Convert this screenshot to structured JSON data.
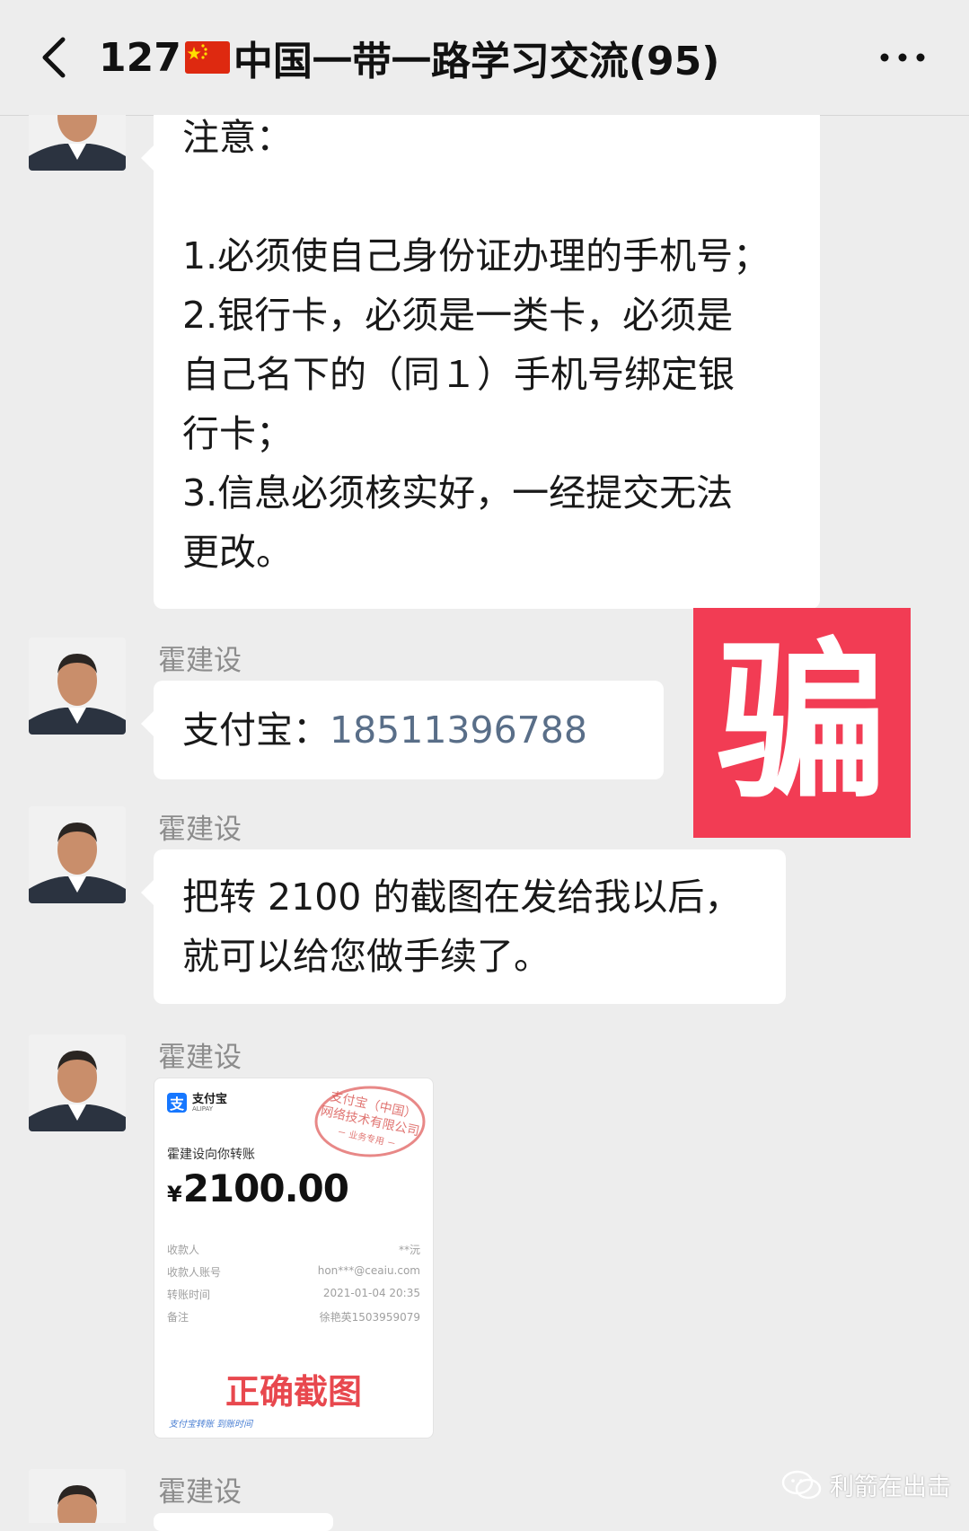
{
  "header": {
    "title_prefix": "127",
    "title_main": "中国一带一路学习交流(95)"
  },
  "messages": [
    {
      "lines": [
        "注意：",
        "",
        "1.必须使自己身份证办理的手机号；",
        "2.银行卡，必须是一类卡，必须是",
        "自己名下的（同１）手机号绑定银",
        "行卡；",
        "3.信息必须核实好，一经提交无法",
        "更改。"
      ]
    },
    {
      "sender": "霍建设",
      "label": "支付宝：",
      "phone": "18511396788"
    },
    {
      "sender": "霍建设",
      "lines": [
        "把转 2100 的截图在发给我以后，",
        "就可以给您做手续了。"
      ]
    },
    {
      "sender": "霍建设",
      "receipt": {
        "logo_text": "支付宝",
        "logo_sub": "ALIPAY",
        "seal_lines": [
          "支付宝（中国）",
          "网络技术有限公司",
          "－ 业务专用 －"
        ],
        "description": "霍建设向你转账",
        "currency": "¥",
        "amount": "2100.00",
        "rows": [
          {
            "label": "收款人",
            "value": "**沅"
          },
          {
            "label": "收款人账号",
            "value": "hon***@ceaiu.com"
          },
          {
            "label": "转账时间",
            "value": "2021-01-04 20:35"
          },
          {
            "label": "备注",
            "value": "徐艳英1503959079"
          }
        ],
        "correct_label": "正确截图",
        "footer": "支付宝转账 到账时间"
      }
    },
    {
      "sender": "霍建设"
    }
  ],
  "stamp": {
    "text": "骗",
    "color": "#f23c54"
  },
  "watermark": {
    "text": "利箭在出击"
  }
}
